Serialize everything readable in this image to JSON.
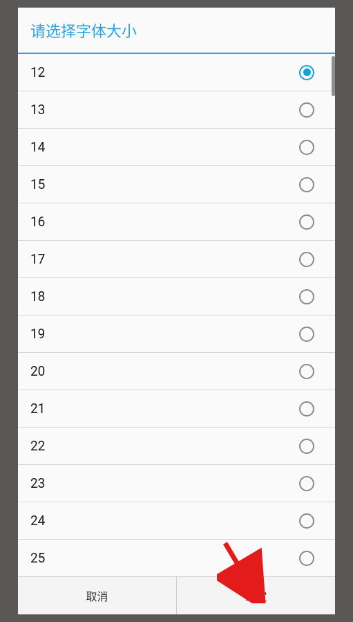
{
  "dialog": {
    "title": "请选择字体大小",
    "selected_value": "12",
    "options": [
      {
        "label": "12",
        "selected": true
      },
      {
        "label": "13",
        "selected": false
      },
      {
        "label": "14",
        "selected": false
      },
      {
        "label": "15",
        "selected": false
      },
      {
        "label": "16",
        "selected": false
      },
      {
        "label": "17",
        "selected": false
      },
      {
        "label": "18",
        "selected": false
      },
      {
        "label": "19",
        "selected": false
      },
      {
        "label": "20",
        "selected": false
      },
      {
        "label": "21",
        "selected": false
      },
      {
        "label": "22",
        "selected": false
      },
      {
        "label": "23",
        "selected": false
      },
      {
        "label": "24",
        "selected": false
      },
      {
        "label": "25",
        "selected": false
      }
    ],
    "buttons": {
      "cancel": "取消",
      "confirm": "确定"
    }
  }
}
